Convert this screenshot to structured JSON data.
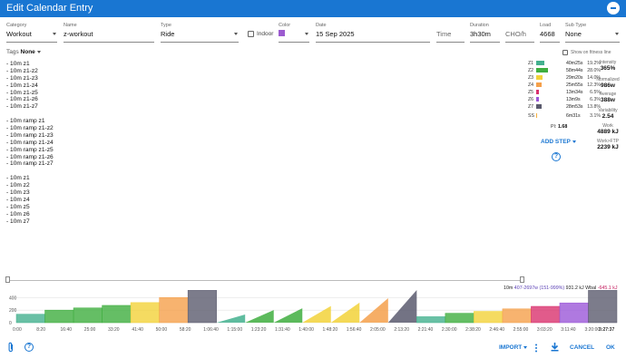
{
  "title": "Edit Calendar Entry",
  "fields": {
    "category": {
      "label": "Category",
      "value": "Workout"
    },
    "name": {
      "label": "Name",
      "value": "z-workout"
    },
    "type": {
      "label": "Type",
      "value": "Ride"
    },
    "indoor": {
      "label": "Indoor",
      "checked": false
    },
    "color": {
      "label": "Color",
      "value": "#9c5bd0"
    },
    "date": {
      "label": "Date",
      "value": "15 Sep 2025"
    },
    "time": {
      "placeholder": "Time"
    },
    "duration": {
      "label": "Duration",
      "value": "3h30m"
    },
    "cho": {
      "placeholder": "CHO/h"
    },
    "load": {
      "label": "Load",
      "value": "4668"
    },
    "subtype": {
      "label": "Sub Type",
      "value": "None"
    }
  },
  "tags": {
    "label": "Tags",
    "value": "None"
  },
  "fitness_label": "Show on fitness line",
  "description_lines": [
    "- 10m z1",
    "- 10m z1-z2",
    "- 10m z1-z3",
    "- 10m z1-z4",
    "- 10m z1-z5",
    "- 10m z1-z6",
    "- 10m z1-z7",
    "",
    "- 10m ramp z1",
    "- 10m ramp z1-z2",
    "- 10m ramp z1-z3",
    "- 10m ramp z1-z4",
    "- 10m ramp z1-z5",
    "- 10m ramp z1-z6",
    "- 10m ramp z1-z7",
    "",
    "- 10m z1",
    "- 10m z2",
    "- 10m z3",
    "- 10m z4",
    "- 10m z5",
    "- 10m z6",
    "- 10m z7"
  ],
  "zones": [
    {
      "name": "Z1",
      "time": "40m25s",
      "pct": "19.2%",
      "color": "#43b08e",
      "fraction": 0.282
    },
    {
      "name": "Z2",
      "time": "58m44s",
      "pct": "28.0%",
      "color": "#3fae3f",
      "fraction": 0.411
    },
    {
      "name": "Z3",
      "time": "29m20s",
      "pct": "14.0%",
      "color": "#f2d23a",
      "fraction": 0.205
    },
    {
      "name": "Z4",
      "time": "25m55s",
      "pct": "12.3%",
      "color": "#f5a04b",
      "fraction": 0.181
    },
    {
      "name": "Z5",
      "time": "13m34s",
      "pct": "6.5%",
      "color": "#d9326e",
      "fraction": 0.095
    },
    {
      "name": "Z6",
      "time": "13m9s",
      "pct": "6.3%",
      "color": "#9b57d8",
      "fraction": 0.092
    },
    {
      "name": "Z7",
      "time": "28m53s",
      "pct": "13.8%",
      "color": "#5b5b6e",
      "fraction": 0.202
    },
    {
      "name": "SS",
      "time": "6m31s",
      "pct": "3.1%",
      "color": "#f7b03f",
      "fraction": 0.046
    }
  ],
  "pi": {
    "label": "PI:",
    "value": "1.68"
  },
  "stats": [
    {
      "label": "Intensity",
      "value": "365%"
    },
    {
      "label": "Normalized",
      "value": "986w"
    },
    {
      "label": "Average",
      "value": "388w"
    },
    {
      "label": "Variability",
      "value": "2.54"
    },
    {
      "label": "Work",
      "value": "4889 kJ"
    },
    {
      "label": "Work>FTP",
      "value": "2239 kJ"
    }
  ],
  "add_step": "ADD STEP",
  "hover": {
    "duration": "10m",
    "power": "407-2697w (151-999%)",
    "energy": "931.2 kJ",
    "wbal_label": "Wbal",
    "wbal": "-645.1 kJ"
  },
  "chart_data": {
    "type": "area",
    "title": "",
    "xlabel": "",
    "ylabel": "",
    "y_ticks": [
      "0",
      "200",
      "400"
    ],
    "ylim": [
      0,
      520
    ],
    "xlim": [
      0,
      210
    ],
    "x_ticks": [
      "0:00",
      "8:20",
      "16:40",
      "25:00",
      "33:20",
      "41:40",
      "50:00",
      "58:20",
      "1:06:40",
      "1:15:00",
      "1:23:20",
      "1:31:40",
      "1:40:00",
      "1:48:20",
      "1:56:40",
      "2:05:00",
      "2:13:20",
      "2:21:40",
      "2:30:00",
      "2:38:20",
      "2:46:40",
      "2:55:00",
      "3:03:20",
      "3:11:40",
      "3:20:00"
    ],
    "end_label": "3:27:37",
    "x_tick_step_minutes": 8.3333,
    "steps": [
      {
        "kind": "block",
        "start": 0,
        "end": 10,
        "lo": 0,
        "hi": 135,
        "zone": "Z1"
      },
      {
        "kind": "block",
        "start": 10,
        "end": 20,
        "lo": 0,
        "hi": 200,
        "zone": "Z2"
      },
      {
        "kind": "block",
        "start": 20,
        "end": 30,
        "lo": 0,
        "hi": 235,
        "zone": "Z2"
      },
      {
        "kind": "block",
        "start": 30,
        "end": 40,
        "lo": 0,
        "hi": 275,
        "zone": "Z2"
      },
      {
        "kind": "block",
        "start": 40,
        "end": 50,
        "lo": 0,
        "hi": 320,
        "zone": "Z3"
      },
      {
        "kind": "block",
        "start": 50,
        "end": 60,
        "lo": 0,
        "hi": 400,
        "zone": "Z4"
      },
      {
        "kind": "block",
        "start": 60,
        "end": 70,
        "lo": 0,
        "hi": 520,
        "zone": "Z7"
      },
      {
        "kind": "ramp",
        "start": 70,
        "end": 80,
        "lo": 0,
        "hi": 130,
        "zone": "Z1"
      },
      {
        "kind": "ramp",
        "start": 80,
        "end": 90,
        "lo": 0,
        "hi": 200,
        "zone": "Z2"
      },
      {
        "kind": "ramp",
        "start": 90,
        "end": 100,
        "lo": 0,
        "hi": 230,
        "zone": "Z2"
      },
      {
        "kind": "ramp",
        "start": 100,
        "end": 110,
        "lo": 0,
        "hi": 265,
        "zone": "Z3"
      },
      {
        "kind": "ramp",
        "start": 110,
        "end": 120,
        "lo": 0,
        "hi": 320,
        "zone": "Z3"
      },
      {
        "kind": "ramp",
        "start": 120,
        "end": 130,
        "lo": 0,
        "hi": 390,
        "zone": "Z4"
      },
      {
        "kind": "ramp",
        "start": 130,
        "end": 140,
        "lo": 0,
        "hi": 520,
        "zone": "Z7"
      },
      {
        "kind": "block",
        "start": 140,
        "end": 150,
        "lo": 0,
        "hi": 95,
        "zone": "Z1"
      },
      {
        "kind": "block",
        "start": 150,
        "end": 160,
        "lo": 0,
        "hi": 150,
        "zone": "Z2"
      },
      {
        "kind": "block",
        "start": 160,
        "end": 170,
        "lo": 0,
        "hi": 180,
        "zone": "Z3"
      },
      {
        "kind": "block",
        "start": 170,
        "end": 180,
        "lo": 0,
        "hi": 220,
        "zone": "Z4"
      },
      {
        "kind": "block",
        "start": 180,
        "end": 190,
        "lo": 0,
        "hi": 260,
        "zone": "Z5"
      },
      {
        "kind": "block",
        "start": 190,
        "end": 200,
        "lo": 0,
        "hi": 315,
        "zone": "Z6"
      },
      {
        "kind": "block",
        "start": 200,
        "end": 210,
        "lo": 0,
        "hi": 520,
        "zone": "Z7"
      }
    ]
  },
  "bottom": {
    "import": "IMPORT",
    "cancel": "CANCEL",
    "ok": "OK"
  }
}
